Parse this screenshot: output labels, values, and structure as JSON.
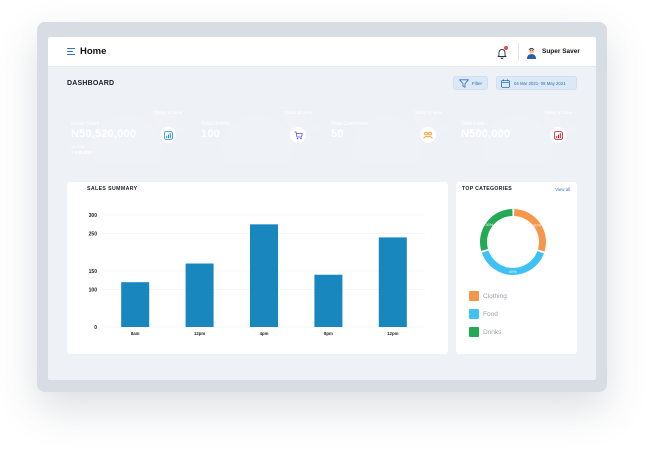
{
  "topbar": {
    "title": "Home",
    "user_name": "Super Saver",
    "menu_icon": "hamburger-icon",
    "bell_icon": "bell-icon"
  },
  "dashboard": {
    "title": "DASHBOARD",
    "filter_label": "Filter",
    "date_range": "04 Mar 2021- 08 May 2021"
  },
  "cards": [
    {
      "date": "Today 10 June",
      "label": "Gross Sales",
      "value": "N50,520,000",
      "sub_label": "Net Total",
      "sub_value": "+ 535,520",
      "icon": "chart-icon",
      "color": "#1a8fcf"
    },
    {
      "date": "Today 10 June",
      "label": "Total Orders",
      "value": "100",
      "icon": "cart-icon",
      "color": "#5a4ff5"
    },
    {
      "date": "Today 10 June",
      "label": "Total Customers",
      "value": "50",
      "icon": "users-icon",
      "color": "#ff8a14"
    },
    {
      "date": "Today 10 June",
      "label": "Total Loss",
      "value": "N500,000",
      "icon": "chart-icon",
      "color": "#cf1820"
    }
  ],
  "sales_summary": {
    "title": "SALES SUMMARY"
  },
  "chart_data": [
    {
      "type": "bar",
      "title": "SALES SUMMARY",
      "categories": [
        "8am",
        "12pm",
        "4pm",
        "8pm",
        "12pm"
      ],
      "values": [
        120,
        170,
        275,
        140,
        240
      ],
      "ylim": [
        0,
        300
      ],
      "yticks": [
        0,
        100,
        150,
        250,
        300
      ],
      "grid": true,
      "color": "#1787bd"
    },
    {
      "type": "pie",
      "title": "TOP CATEGORIES",
      "labels": [
        "Clothing",
        "Food",
        "Drinks"
      ],
      "values": [
        30,
        40,
        30
      ],
      "slice_labels": [
        "30%",
        "40%",
        "30%"
      ],
      "colors": [
        "#f5974a",
        "#3fc1f5",
        "#22aa55"
      ]
    }
  ],
  "top_categories": {
    "title": "TOP CATEGORIES",
    "view_all": "View all",
    "legend": [
      {
        "label": "Clothing",
        "color": "#f5974a"
      },
      {
        "label": "Food",
        "color": "#3fc1f5"
      },
      {
        "label": "Drinks",
        "color": "#22aa55"
      }
    ]
  }
}
